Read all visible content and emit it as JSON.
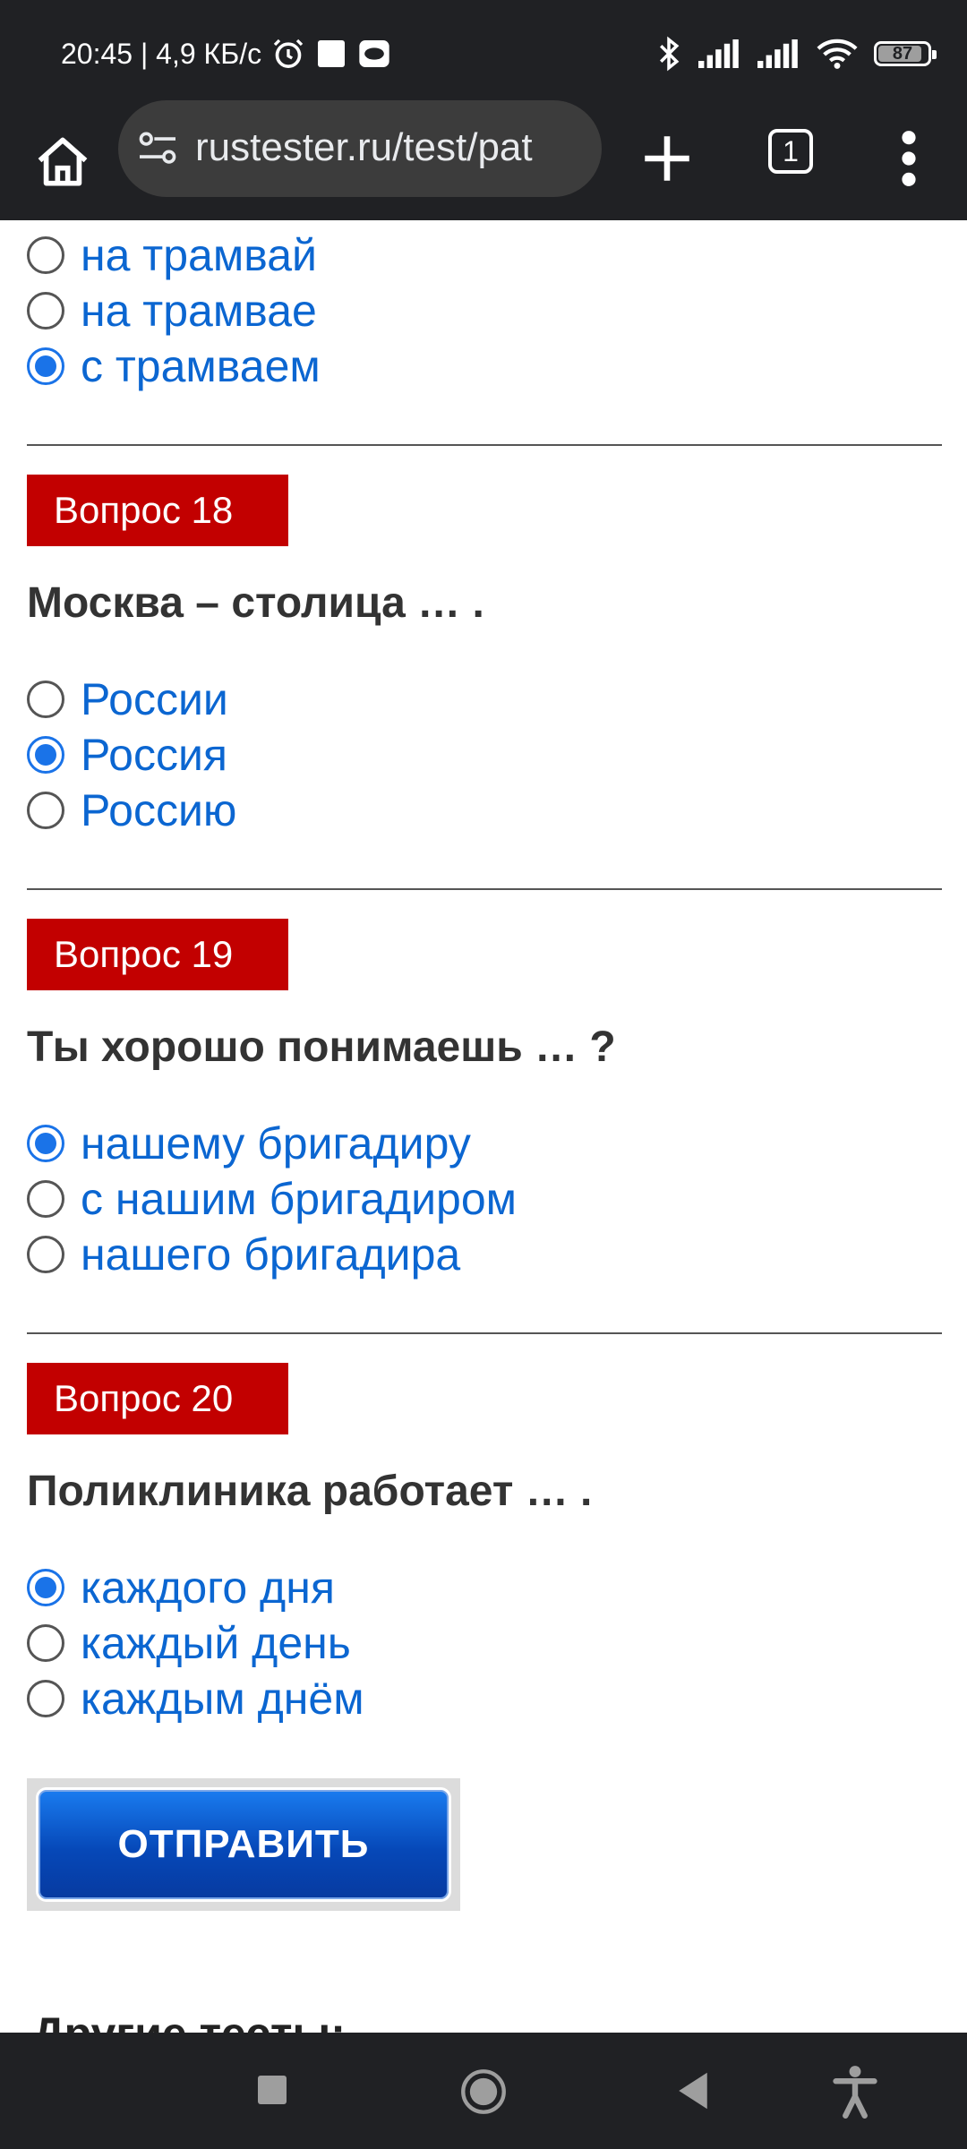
{
  "status_bar": {
    "time_speed": "20:45 | 4,9 КБ/с",
    "battery": "87"
  },
  "browser": {
    "url": "rustester.ru/test/pat",
    "tab_count": "1"
  },
  "prev_question": {
    "options": [
      {
        "label": "на трамвай",
        "checked": false
      },
      {
        "label": "на трамвае",
        "checked": false
      },
      {
        "label": "с трамваем",
        "checked": true
      }
    ]
  },
  "questions": [
    {
      "badge": "Вопрос 18",
      "title": "Москва – столица … .",
      "options": [
        {
          "label": "России",
          "checked": false
        },
        {
          "label": "Россия",
          "checked": true
        },
        {
          "label": "Россию",
          "checked": false
        }
      ]
    },
    {
      "badge": "Вопрос 19",
      "title": "Ты хорошо понимаешь … ?",
      "options": [
        {
          "label": "нашему бригадиру",
          "checked": true
        },
        {
          "label": "с нашим бригадиром",
          "checked": false
        },
        {
          "label": "нашего бригадира",
          "checked": false
        }
      ]
    },
    {
      "badge": "Вопрос 20",
      "title": "Поликлиника работает … .",
      "options": [
        {
          "label": "каждого дня",
          "checked": true
        },
        {
          "label": "каждый день",
          "checked": false
        },
        {
          "label": "каждым днём",
          "checked": false
        }
      ]
    }
  ],
  "submit_label": "ОТПРАВИТЬ",
  "other_tests": "Другие тесты:",
  "colors": {
    "link_blue": "#0b66d1",
    "badge_red": "#c20000",
    "radio_blue": "#1a73e8"
  }
}
